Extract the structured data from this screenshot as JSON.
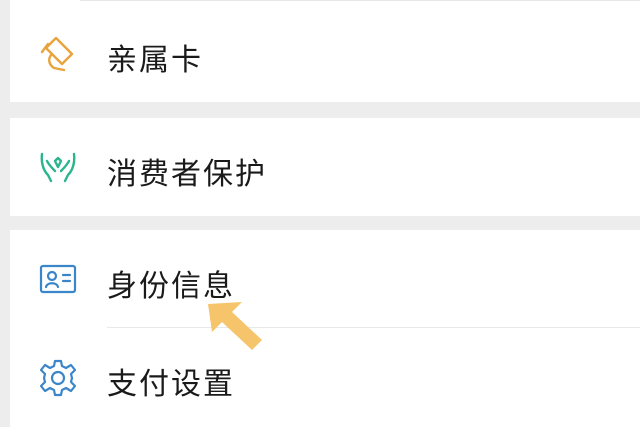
{
  "menu": {
    "family_card": {
      "label": "亲属卡",
      "icon": "family-card-icon",
      "icon_color": "#e8a33d"
    },
    "consumer_protection": {
      "label": "消费者保护",
      "icon": "protection-hands-icon",
      "icon_color": "#2bb58f"
    },
    "identity_info": {
      "label": "身份信息",
      "icon": "id-card-icon",
      "icon_color": "#3a86c8"
    },
    "payment_settings": {
      "label": "支付设置",
      "icon": "gear-icon",
      "icon_color": "#3a86c8"
    }
  },
  "annotation": {
    "arrow_color": "#f6c46a"
  }
}
